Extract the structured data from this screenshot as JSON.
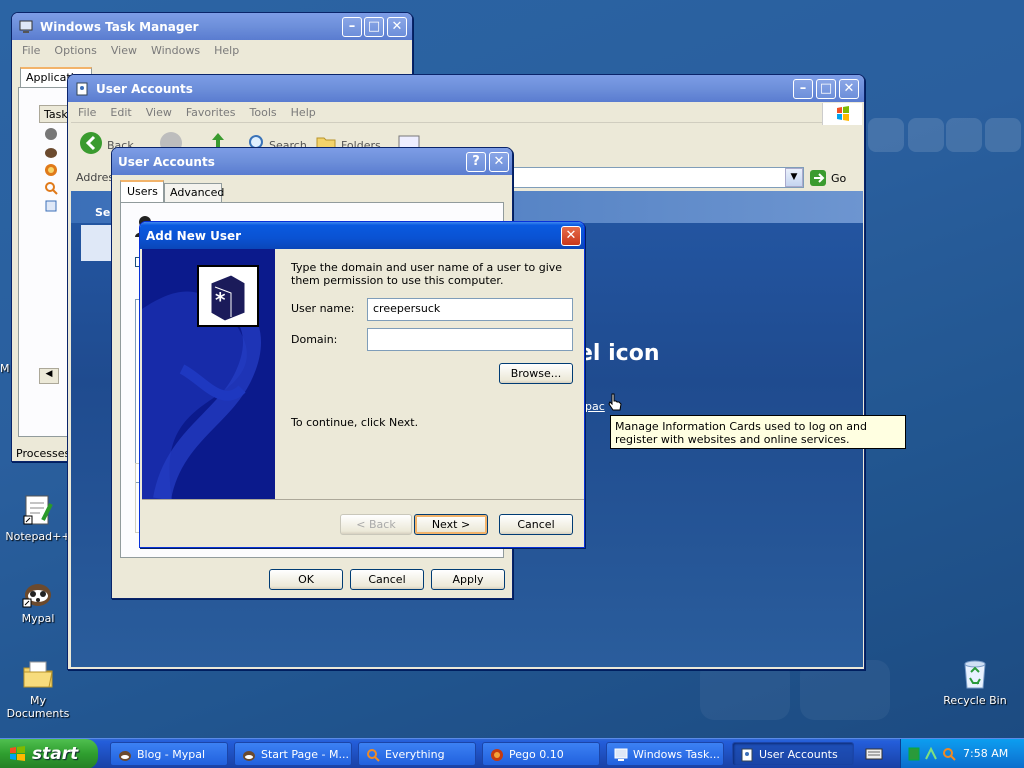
{
  "desktop": {
    "icons": [
      {
        "label": "Notepad++",
        "icon": "notepad-plus-plus-icon"
      },
      {
        "label": "Mypal",
        "icon": "mypal-icon"
      },
      {
        "label": "My Documents",
        "icon": "my-documents-icon"
      },
      {
        "label": "Recycle Bin",
        "icon": "recycle-bin-icon"
      }
    ],
    "edge_letter": "M"
  },
  "task_manager": {
    "title": "Windows Task Manager",
    "menu": [
      "File",
      "Options",
      "View",
      "Windows",
      "Help"
    ],
    "tab_first": "Applications",
    "column_header": "Task",
    "status": "Processes:"
  },
  "control_panel": {
    "title": "User Accounts",
    "menu": [
      "File",
      "Edit",
      "View",
      "Favorites",
      "Tools",
      "Help"
    ],
    "toolbar": {
      "back": "Back",
      "search": "Search",
      "folders": "Folders"
    },
    "address_label": "Address",
    "go_label": "Go",
    "heading_fragment": "el icon",
    "link_fragment": "Spac",
    "see_also": "Se",
    "tooltip": "Manage Information Cards used to log on and register with websites and online services."
  },
  "user_accounts_dialog": {
    "title": "User Accounts",
    "tabs": [
      "Users",
      "Advanced"
    ],
    "buttons": {
      "ok": "OK",
      "cancel": "Cancel",
      "apply": "Apply"
    }
  },
  "add_new_user": {
    "title": "Add New User",
    "instructions": "Type the domain and user name of a user to give them permission to use this computer.",
    "username_label": "User name:",
    "username_value": "creepersuck",
    "domain_label": "Domain:",
    "domain_value": "",
    "browse_label": "Browse...",
    "continue_text": "To continue, click Next.",
    "back_label": "< Back",
    "next_label": "Next >",
    "cancel_label": "Cancel"
  },
  "taskbar": {
    "start_label": "start",
    "items": [
      {
        "label": "Blog - Mypal",
        "active": false
      },
      {
        "label": "Start Page - M...",
        "active": false
      },
      {
        "label": "Everything",
        "active": false
      },
      {
        "label": "Pego 0.10",
        "active": false
      },
      {
        "label": "Windows Task...",
        "active": false
      },
      {
        "label": "User Accounts",
        "active": true
      }
    ],
    "clock": "7:58 AM"
  }
}
